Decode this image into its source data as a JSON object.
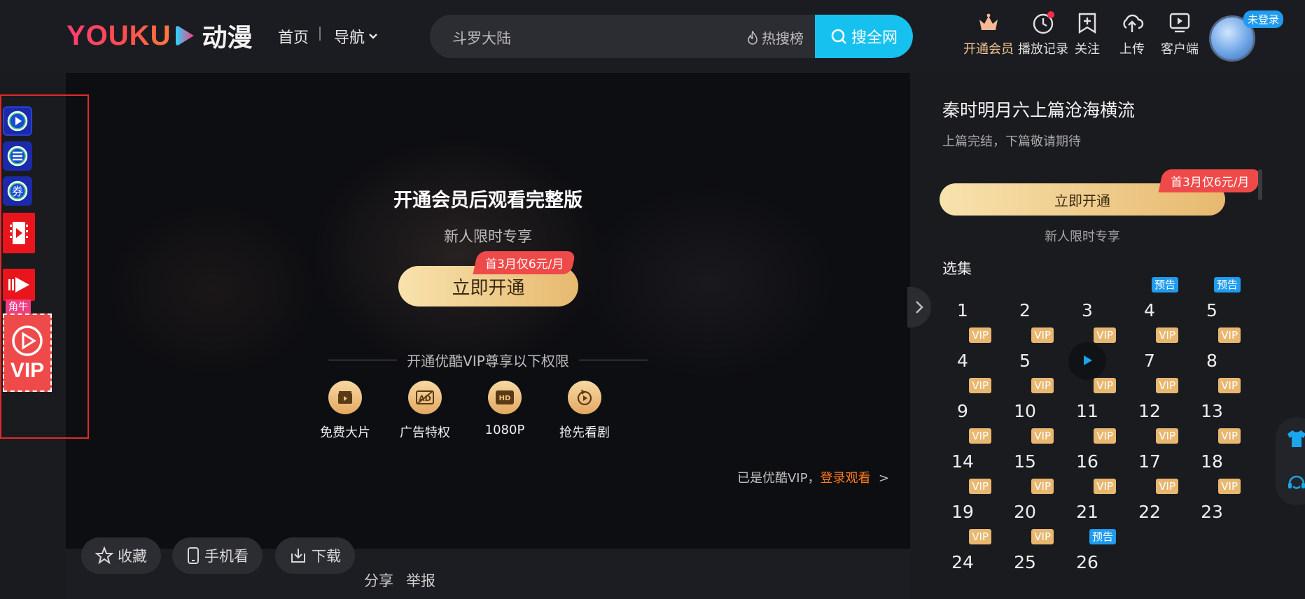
{
  "header": {
    "logo_text": "YOUKU",
    "logo_channel": "动漫",
    "nav": {
      "home": "首页",
      "guide": "导航"
    },
    "search": {
      "value": "斗罗大陆",
      "hot_label": "热搜榜",
      "button_label": "搜全网"
    },
    "icons": [
      {
        "name": "crown-icon",
        "label": "开通会员"
      },
      {
        "name": "history-icon",
        "label": "播放记录"
      },
      {
        "name": "follow-icon",
        "label": "关注"
      },
      {
        "name": "upload-icon",
        "label": "上传"
      },
      {
        "name": "client-icon",
        "label": "客户端"
      }
    ],
    "login_badge": "未登录"
  },
  "player": {
    "title": "开通会员后观看完整版",
    "subtitle": "新人限时专享",
    "open_button": "立即开通",
    "promo": "首3月仅6元/月",
    "rights_title": "开通优酷VIP尊享以下权限",
    "perks": [
      {
        "icon": "film-icon",
        "label": "免费大片"
      },
      {
        "icon": "ad-icon",
        "label": "广告特权"
      },
      {
        "icon": "hd-icon",
        "label": "1080P"
      },
      {
        "icon": "early-access-icon",
        "label": "抢先看剧"
      }
    ],
    "login_tip_prefix": "已是优酷VIP，",
    "login_tip_link": "登录观看",
    "login_tip_arrow": ">"
  },
  "actions": {
    "favorite": "收藏",
    "mobile": "手机看",
    "download": "下载",
    "share": "分享",
    "report": "举报"
  },
  "side_panel": {
    "title": "秦时明月六上篇沧海横流",
    "subtitle": "上篇完结，下篇敬请期待",
    "open_button": "立即开通",
    "promo": "首3月仅6元/月",
    "limited": "新人限时专享",
    "episodes_heading": "选集",
    "episodes": [
      {
        "num": "1",
        "tag": ""
      },
      {
        "num": "2",
        "tag": ""
      },
      {
        "num": "3",
        "tag": ""
      },
      {
        "num": "4",
        "tag": "预告"
      },
      {
        "num": "5",
        "tag": "预告"
      },
      {
        "num": "4",
        "tag": "VIP"
      },
      {
        "num": "5",
        "tag": "VIP"
      },
      {
        "num": "",
        "tag": "VIP",
        "playing": true
      },
      {
        "num": "7",
        "tag": "VIP"
      },
      {
        "num": "8",
        "tag": "VIP"
      },
      {
        "num": "9",
        "tag": "VIP"
      },
      {
        "num": "10",
        "tag": "VIP"
      },
      {
        "num": "11",
        "tag": "VIP"
      },
      {
        "num": "12",
        "tag": "VIP"
      },
      {
        "num": "13",
        "tag": "VIP"
      },
      {
        "num": "14",
        "tag": "VIP"
      },
      {
        "num": "15",
        "tag": "VIP"
      },
      {
        "num": "16",
        "tag": "VIP"
      },
      {
        "num": "17",
        "tag": "VIP"
      },
      {
        "num": "18",
        "tag": "VIP"
      },
      {
        "num": "19",
        "tag": "VIP"
      },
      {
        "num": "20",
        "tag": "VIP"
      },
      {
        "num": "21",
        "tag": "VIP"
      },
      {
        "num": "22",
        "tag": "VIP"
      },
      {
        "num": "23",
        "tag": "VIP"
      },
      {
        "num": "24",
        "tag": "VIP"
      },
      {
        "num": "25",
        "tag": "VIP"
      },
      {
        "num": "26",
        "tag": "预告"
      }
    ]
  },
  "extension_bar": {
    "items": [
      "play-icon",
      "menu-icon",
      "coupon-icon",
      "video-icon",
      "forward-icon",
      "vip-play-icon"
    ],
    "coupon_glyph": "券",
    "small_label": "角牛",
    "vip_label": "VIP"
  },
  "colors": {
    "accent": "#17c1ef",
    "vip_gold": "#e8b770",
    "promo_red": "#ef4a4a",
    "link_orange": "#ff7a1f"
  }
}
